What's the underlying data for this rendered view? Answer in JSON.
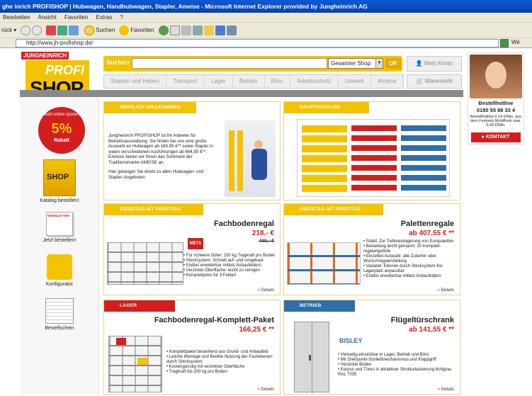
{
  "window": {
    "title": "ghe inrich PROFISHOP | Hubwagen, Handhubwagen, Stapler, Ameise - Microsoft Internet Explorer provided by Jungheinrich AG"
  },
  "menu": [
    "Bearbeiten",
    "Ansicht",
    "Favoriten",
    "Extras",
    "?"
  ],
  "toolbar": {
    "back_label": "rück",
    "search_label": "Suchen",
    "favorites_label": "Favoriten"
  },
  "address": {
    "url": "http://www.jh-profishop.de/",
    "extra": "We"
  },
  "header": {
    "brand": "JUNGHEINRICH",
    "logo_top": "PROFI",
    "logo_bottom": "SHOP",
    "search_label": "Suchen",
    "search_placeholder": "",
    "search_scope": "Gesamter Shop",
    "search_button": "OK",
    "account_label": "Mein Konto",
    "basket_label": "Warenkorb"
  },
  "nav": [
    "Stapeln und Heben",
    "Transport",
    "Lager",
    "Betrieb",
    "Büro",
    "Arbeitsschutz",
    "Umwelt",
    "Ameise"
  ],
  "hotline": {
    "title": "Bestellhotline",
    "number": "0180 55 88 33 4",
    "note": "Bestellhotline 0,14 €/Min. aus dem Festnetz Mobilfunk max. 0,42 €/Min.",
    "contact_button": "KONTAKT"
  },
  "sidebar": {
    "badge_top": "Jetzt online sparen!",
    "badge_value": "5%",
    "badge_bottom": "Rabatt",
    "catalog_cover": "SHOP",
    "newsletter_label": "NEWSLETTER",
    "items": [
      {
        "label": "Katalog bestellen!"
      },
      {
        "label": "Jetzt bestellen!"
      },
      {
        "label": "Konfigurator"
      },
      {
        "label": "Bestellschein"
      }
    ]
  },
  "welcome": {
    "header": "HERZLICH WILLKOMMEN",
    "para1": "Jungheinrich PROFISHOP ist Ihr Anbieter für Betriebsausstattung. Sie finden bei uns eine große Auswahl an Hubwagen ab 189,95 €** sowie Stapler in vielen verschiedenen Ausführungen ab 664,95 €**. Exklusiv bieten wir Ihnen das Sortiment der Traditionsmarke AMEISE an.",
    "para2": "Hier gelangen Sie direkt zu allen Hubwagen- und Stapler-Angeboten."
  },
  "catalog": {
    "header": "HAUPTKATALOG"
  },
  "products": [
    {
      "header": "DIENSTAG IST PROFITAG",
      "title": "Fachbodenregal",
      "price": "218,- €",
      "old_price": "488,- €",
      "brand": "META",
      "bullets": [
        "Für schwere Güter: 230 kg Tragkraft pro Boden",
        "Stecksystem: Schnell auf- und umgebaut",
        "Endlos erweiterbar mittels Anbaufeldern",
        "Verzinkte Oberfläche: leicht zu reinigen",
        "Komplettpreis für 3 Felder!"
      ],
      "details": "Details"
    },
    {
      "header": "DIENSTAG IST PROFITAG",
      "title": "Palettenregale",
      "price": "ab 407,55 € **",
      "bullets": [
        "Stabil: Zur Tiefeneinlagerung von Europaletten",
        "Bestellung leicht gemacht: 20 Komplett-regalangebote",
        "Einzelteil-Auswahl: alle Zubehör oder Wunschregalerstellung",
        "Variabel: Ebenen durch Stecksystem frei Lagerplatz anpassbar",
        "Endlos erweiterbar mittels Anbaufeldern"
      ],
      "details": "Details"
    },
    {
      "header": "LAGER",
      "title": "Fachbodenregal-Komplett-Paket",
      "price": "166,25 € **",
      "bullets": [
        "Komplettpaket bestehend aus Grund- und Anbaufeld",
        "Leichte Montage und flexible Nutzung der Fachebenen durch Stecksystem",
        "Kostengünstig mit verzinkter Oberfläche",
        "Tragkraft bis 100 kg pro Boden"
      ],
      "details": "Details"
    },
    {
      "header": "BETRIEB",
      "title": "Flügeltürschrank",
      "price": "ab 141,55 € **",
      "brand": "BISLEY",
      "bullets": [
        "Vielseitig einsetzbar in Lager, Betrieb und Büro",
        "Mit Drehpunkt-Schließmechanismus und Klappgriff",
        "Verzinkte Böden",
        "Korpus und Türen in attraktiver Strukturlackierung lichtgrau RAL 7035"
      ],
      "details": "Details"
    }
  ]
}
